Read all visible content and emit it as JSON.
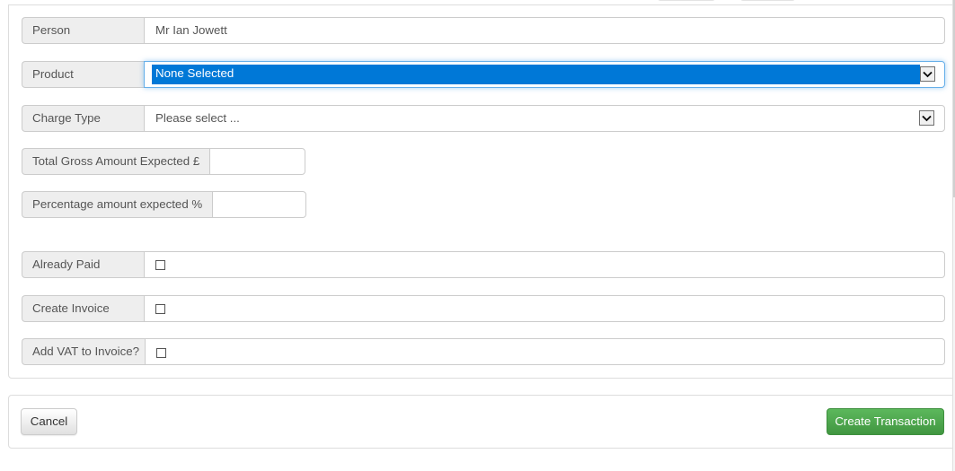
{
  "form": {
    "person": {
      "label": "Person",
      "value": "Mr Ian Jowett"
    },
    "product": {
      "label": "Product",
      "selected": "None Selected"
    },
    "charge_type": {
      "label": "Charge Type",
      "selected": "Please select ..."
    },
    "total_gross": {
      "label": "Total Gross Amount Expected £",
      "value": ""
    },
    "percentage": {
      "label": "Percentage amount expected %",
      "value": ""
    },
    "already_paid": {
      "label": "Already Paid",
      "checked": false
    },
    "create_invoice": {
      "label": "Create Invoice",
      "checked": false
    },
    "add_vat": {
      "label": "Add VAT to Invoice?",
      "checked": false
    }
  },
  "footer": {
    "cancel_label": "Cancel",
    "create_label": "Create Transaction"
  },
  "icons": {
    "dropdown": "chevron-down-icon",
    "checkbox": "checkbox-unchecked"
  },
  "colors": {
    "primary_success": "#5cb85c",
    "selection_highlight": "#0078d7",
    "focus_border": "#66afe9",
    "addon_bg": "#eeeeee"
  }
}
